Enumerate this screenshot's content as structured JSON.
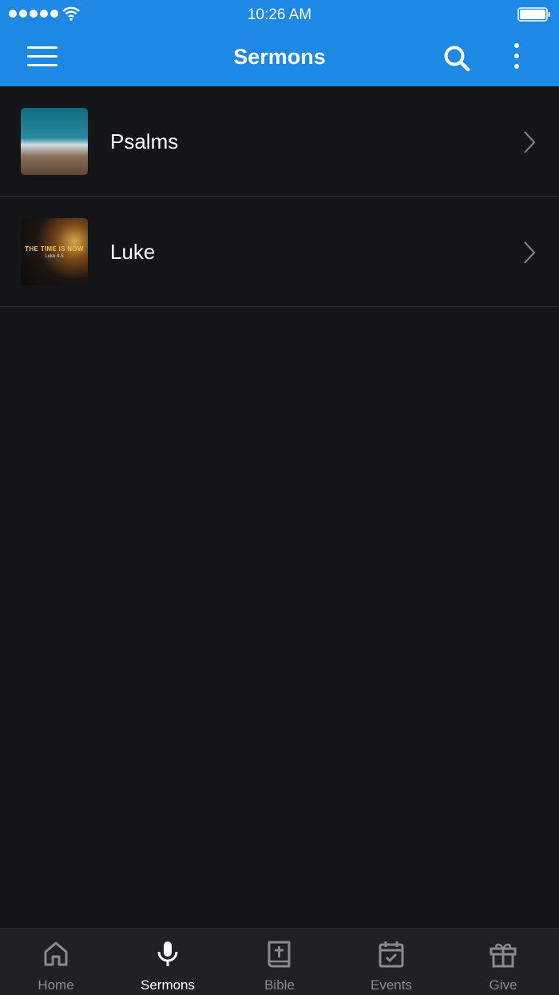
{
  "status_bar": {
    "time": "10:26 AM"
  },
  "app_bar": {
    "title": "Sermons"
  },
  "sermons": [
    {
      "label": "Psalms",
      "thumbnail": "mountain-photo"
    },
    {
      "label": "Luke",
      "thumbnail": "the-time-is-now-artwork",
      "thumb_title": "THE TIME IS NOW",
      "thumb_subtitle": "Luke 4-5"
    }
  ],
  "tabs": [
    {
      "label": "Home",
      "icon": "home-icon",
      "active": false
    },
    {
      "label": "Sermons",
      "icon": "microphone-icon",
      "active": true
    },
    {
      "label": "Bible",
      "icon": "bible-icon",
      "active": false
    },
    {
      "label": "Events",
      "icon": "calendar-check-icon",
      "active": false
    },
    {
      "label": "Give",
      "icon": "gift-icon",
      "active": false
    }
  ],
  "colors": {
    "accent": "#1e88e5",
    "background": "#141517",
    "tab_bar": "#202124"
  }
}
